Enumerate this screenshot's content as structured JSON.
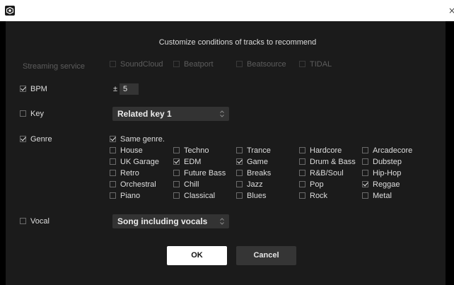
{
  "window": {
    "close_glyph": "×"
  },
  "heading": "Customize conditions of tracks to recommend",
  "streaming": {
    "label": "Streaming service",
    "services": [
      "SoundCloud",
      "Beatport",
      "Beatsource",
      "TIDAL"
    ]
  },
  "bpm": {
    "label": "BPM",
    "checked": true,
    "plusminus": "±",
    "value": "5"
  },
  "key": {
    "label": "Key",
    "checked": false,
    "selected": "Related key 1"
  },
  "genre": {
    "label": "Genre",
    "checked": true,
    "same_genre": "Same genre.",
    "items": [
      [
        "House",
        "Techno",
        "Trance",
        "Hardcore",
        "Arcadecore"
      ],
      [
        "UK Garage",
        "EDM",
        "Game",
        "Drum & Bass",
        "Dubstep"
      ],
      [
        "Retro",
        "Future Bass",
        "Breaks",
        "R&B/Soul",
        "Hip-Hop"
      ],
      [
        "Orchestral",
        "Chill",
        "Jazz",
        "Pop",
        "Reggae"
      ],
      [
        "Piano",
        "Classical",
        "Blues",
        "Rock",
        "Metal"
      ]
    ],
    "checked_items": [
      "EDM",
      "Game",
      "Reggae"
    ]
  },
  "vocal": {
    "label": "Vocal",
    "checked": false,
    "selected": "Song including vocals"
  },
  "buttons": {
    "ok": "OK",
    "cancel": "Cancel"
  },
  "icons": {
    "app": "app-logo-icon",
    "select_arrows": "chevron-updown-icon"
  }
}
